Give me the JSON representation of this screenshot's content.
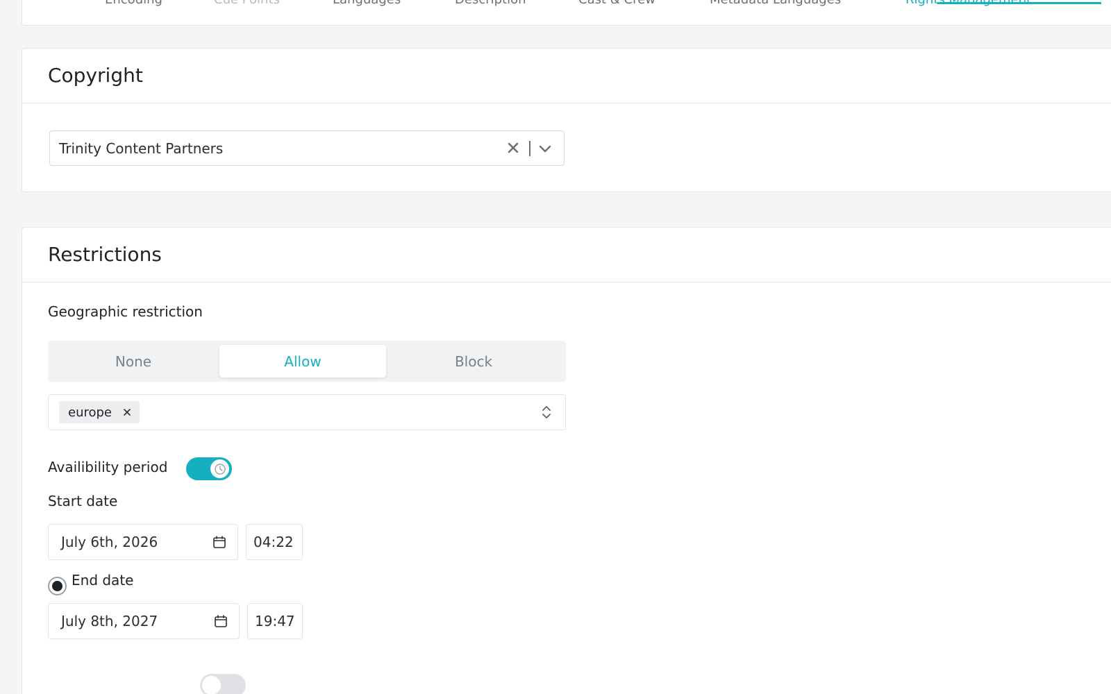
{
  "tabs": [
    {
      "label": "Encoding",
      "state": "normal"
    },
    {
      "label": "Cue Points",
      "state": "disabled"
    },
    {
      "label": "Languages",
      "state": "normal"
    },
    {
      "label": "Description",
      "state": "normal"
    },
    {
      "label": "Cast & Crew",
      "state": "normal"
    },
    {
      "label": "Metadata Languages",
      "state": "normal"
    },
    {
      "label": "Rights Management",
      "state": "active"
    }
  ],
  "colors": {
    "accent": "#14b0bf"
  },
  "copyright": {
    "title": "Copyright",
    "selected_value": "Trinity Content Partners",
    "clear_icon": "close-icon",
    "dropdown_icon": "chevron-down-icon"
  },
  "restrictions": {
    "title": "Restrictions",
    "geo_label": "Geographic restriction",
    "geo_options": [
      "None",
      "Allow",
      "Block"
    ],
    "geo_selected": "Allow",
    "regions": [
      "europe"
    ],
    "availability_label": "Availibility period",
    "availability_enabled": true,
    "start_label": "Start date",
    "start_date": "July 6th, 2026",
    "start_time": "04:22",
    "end_label": "End date",
    "end_selected": true,
    "end_date": "July 8th, 2027",
    "end_time": "19:47",
    "next_toggle_enabled": false
  }
}
